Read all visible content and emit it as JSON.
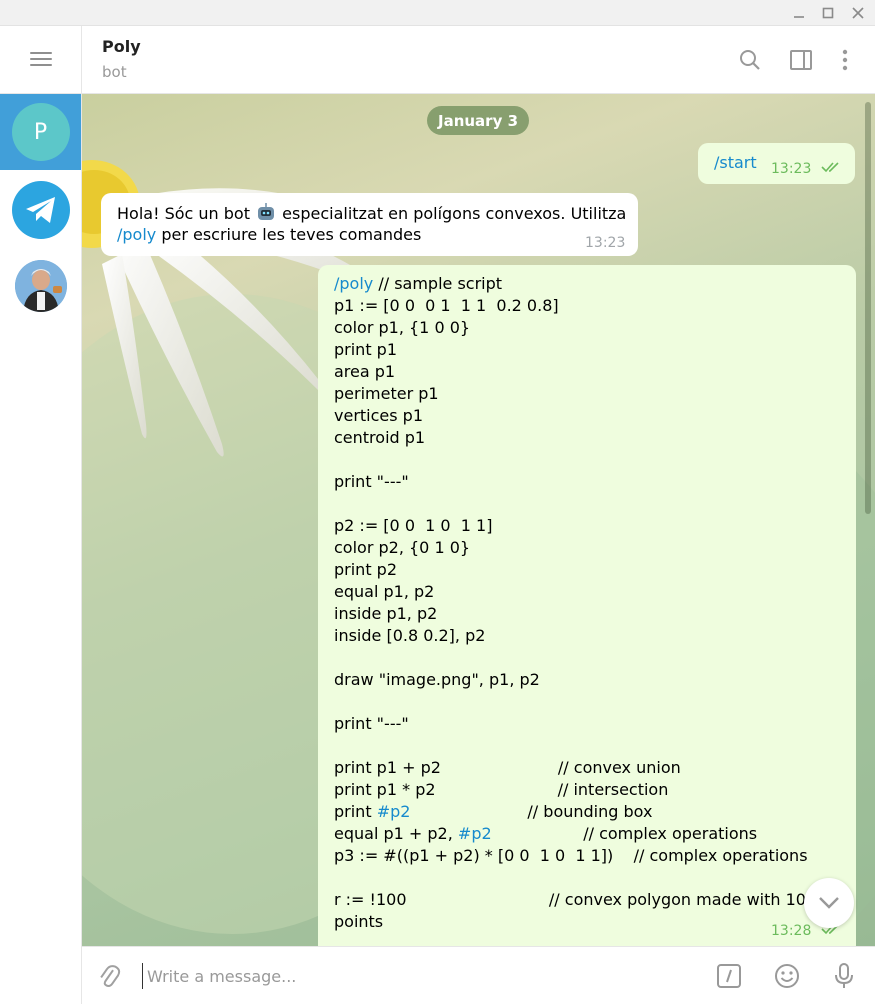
{
  "window": {
    "minimize_icon": "minimize-icon",
    "maximize_icon": "maximize-icon",
    "close_icon": "close-icon"
  },
  "header": {
    "title": "Poly",
    "subtitle": "bot"
  },
  "sidebar": {
    "chats": [
      {
        "initial": "P",
        "color": "#5cc7c9",
        "active": true
      },
      {
        "icon": "telegram-icon",
        "color": "#2ca5e0"
      },
      {
        "icon": "person-avatar",
        "color": "#6aa6d6"
      }
    ]
  },
  "messages": {
    "date": "January 3",
    "start": {
      "text": "/start",
      "time": "13:23"
    },
    "greeting": {
      "line1_a": "Hola! Sóc un bot ",
      "line1_b": " especialitzat en polígons convexos. Utilitza",
      "line2_link": "/poly",
      "line2_rest": " per escriure les teves comandes",
      "time": "13:23"
    },
    "script": {
      "lines": [
        {
          "link": "/poly",
          "text": " // sample script"
        },
        {
          "text": "p1 := [0 0  0 1  1 1  0.2 0.8]"
        },
        {
          "text": "color p1, {1 0 0}"
        },
        {
          "text": "print p1"
        },
        {
          "text": "area p1"
        },
        {
          "text": "perimeter p1"
        },
        {
          "text": "vertices p1"
        },
        {
          "text": "centroid p1"
        },
        {
          "text": ""
        },
        {
          "text": "print \"---\""
        },
        {
          "text": ""
        },
        {
          "text": "p2 := [0 0  1 0  1 1]"
        },
        {
          "text": "color p2, {0 1 0}"
        },
        {
          "text": "print p2"
        },
        {
          "text": "equal p1, p2"
        },
        {
          "text": "inside p1, p2"
        },
        {
          "text": "inside [0.8 0.2], p2"
        },
        {
          "text": ""
        },
        {
          "text": "draw \"image.png\", p1, p2"
        },
        {
          "text": ""
        },
        {
          "text": "print \"---\""
        },
        {
          "text": ""
        },
        {
          "text": "print p1 + p2                       // convex union"
        },
        {
          "text": "print p1 * p2                        // intersection"
        },
        {
          "text": "print ",
          "link": "#p2",
          "rest": "                       // bounding box"
        },
        {
          "text": "equal p1 + p2, ",
          "link": "#p2",
          "rest": "                  // complex operations"
        },
        {
          "text": "p3 := #((p1 + p2) * [0 0  1 0  1 1])    // complex operations"
        },
        {
          "text": ""
        },
        {
          "text": "r := !100                            // convex polygon made with 100 random"
        },
        {
          "text": "points"
        }
      ],
      "time": "13:28"
    }
  },
  "composer": {
    "placeholder": "Write a message..."
  }
}
